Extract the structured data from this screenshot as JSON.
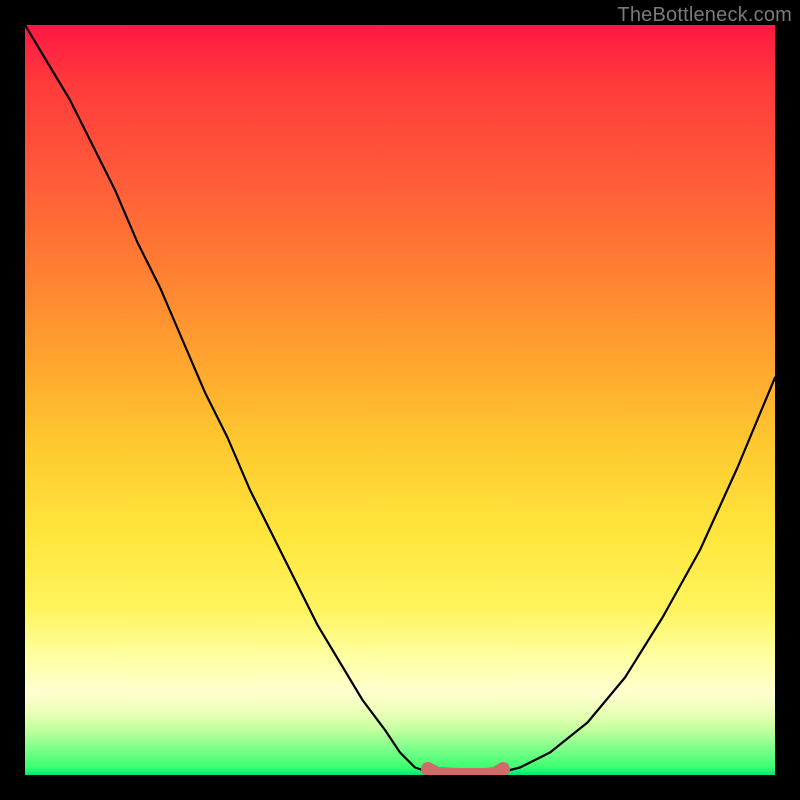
{
  "watermark": "TheBottleneck.com",
  "chart_data": {
    "type": "line",
    "title": "",
    "xlabel": "",
    "ylabel": "",
    "xlim": [
      0,
      100
    ],
    "ylim": [
      0,
      100
    ],
    "series": [
      {
        "name": "curve",
        "x": [
          0,
          3,
          6,
          9,
          12,
          15,
          18,
          21,
          24,
          27,
          30,
          33,
          36,
          39,
          42,
          45,
          48,
          50,
          52,
          55,
          58,
          62,
          66,
          70,
          75,
          80,
          85,
          90,
          95,
          100
        ],
        "y": [
          100,
          95,
          90,
          84,
          78,
          71,
          65,
          58,
          51,
          45,
          38,
          32,
          26,
          20,
          15,
          10,
          6,
          3,
          1,
          0,
          0,
          0,
          1,
          3,
          7,
          13,
          21,
          30,
          41,
          53
        ]
      }
    ],
    "highlight": {
      "name": "bottom-band",
      "x_range": [
        54,
        63
      ],
      "y": 0,
      "color": "#d36a6a"
    },
    "gradient_stops": [
      {
        "pos": 0.0,
        "color": "#ff1744"
      },
      {
        "pos": 0.2,
        "color": "#ff5a3a"
      },
      {
        "pos": 0.44,
        "color": "#ffa22f"
      },
      {
        "pos": 0.68,
        "color": "#ffe63c"
      },
      {
        "pos": 0.86,
        "color": "#ffffcc"
      },
      {
        "pos": 0.96,
        "color": "#8fff92"
      },
      {
        "pos": 1.0,
        "color": "#00e676"
      }
    ]
  }
}
